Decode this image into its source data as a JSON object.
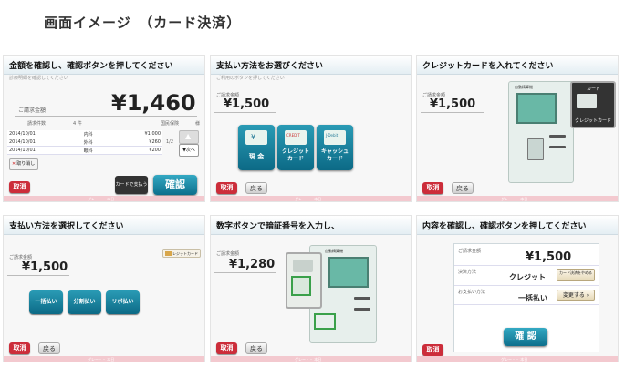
{
  "page_title": "画面イメージ　（カード決済）",
  "common": {
    "cancel": "取消",
    "back": "戻る"
  },
  "p1": {
    "title": "金額を確認し、確認ボタンを押してください",
    "sub": "診療明細を確認してください",
    "amount_label": "ご請求金額",
    "amount": "¥1,460",
    "count_label": "請求件数",
    "count": "4 件",
    "cols": [
      "国民保険",
      "様"
    ],
    "rows": [
      {
        "date": "2014/10/01",
        "dept": "内科",
        "amount": "¥1,000"
      },
      {
        "date": "2014/10/01",
        "dept": "外科",
        "amount": "¥260"
      },
      {
        "date": "2014/10/01",
        "dept": "眼科",
        "amount": "¥200"
      }
    ],
    "page_indicator": "1/2",
    "next": "次へ",
    "withdraw": "取り消し",
    "card_pay": "カードで支払う",
    "confirm": "確認"
  },
  "p2": {
    "title": "支払い方法をお選びください",
    "sub": "ご利用のボタンを押してください",
    "amount_label": "ご請求金額",
    "amount": "¥1,500",
    "methods": [
      {
        "line1": "現 金",
        "line2": ""
      },
      {
        "line1": "クレジット",
        "line2": "カード",
        "tag": "CREDIT"
      },
      {
        "line1": "キャッシュ",
        "line2": "カード",
        "tag": "J-Debit"
      }
    ]
  },
  "p3": {
    "title": "クレジットカードを入れてください",
    "amount_label": "ご請求金額",
    "amount": "¥1,500",
    "kiosk_label": "自動精算機",
    "callout_card": "カード",
    "callout_label": "クレジットカード"
  },
  "p4": {
    "title": "支払い方法を選択してください",
    "amount_label": "ご請求金額",
    "amount": "¥1,500",
    "badge": "クレジットカード",
    "options": [
      "一括払い",
      "分割払い",
      "リボ払い"
    ]
  },
  "p5": {
    "title": "数字ボタンで暗証番号を入力し、",
    "amount_label": "ご請求金額",
    "amount": "¥1,280",
    "kiosk_label": "自動精算機"
  },
  "p6": {
    "title": "内容を確認し、確認ボタンを押してください",
    "amount_label": "ご請求金額",
    "amount": "¥1,500",
    "method_label": "決済方法",
    "method": "クレジット",
    "method_btn": "カード決済をやめる",
    "plan_label": "お支払い方法",
    "plan": "一括払い",
    "plan_btn": "変更する",
    "confirm": "確 認"
  },
  "footer_text": "グレー・・ 本日"
}
